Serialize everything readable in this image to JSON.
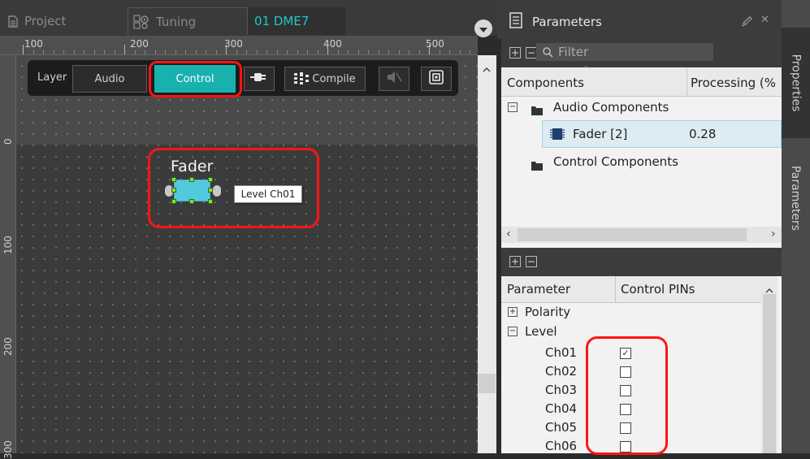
{
  "tabs": [
    {
      "label": "Project",
      "icon": "document-icon"
    },
    {
      "label": "Tuning",
      "icon": "tuning-icon"
    },
    {
      "label": "01 DME7",
      "icon": ""
    }
  ],
  "ruler": {
    "h_labels": [
      "100",
      "200",
      "300",
      "400",
      "500"
    ],
    "v_labels": [
      "0",
      "100",
      "200",
      "300"
    ]
  },
  "toolbar": {
    "layer_label": "Layer",
    "audio_label": "Audio",
    "control_label": "Control",
    "compile_label": "Compile"
  },
  "component": {
    "title": "Fader",
    "tooltip": "Level Ch01"
  },
  "panel": {
    "title": "Parameters",
    "filter_placeholder": "Filter",
    "col_components": "Components",
    "col_processing": "Processing (%",
    "audio_components": "Audio Components",
    "fader_item": "Fader [2]",
    "fader_value": "0.28",
    "control_components": "Control Components",
    "col_parameter": "Parameter",
    "col_control_pins": "Control PINs",
    "polarity": "Polarity",
    "level": "Level",
    "channels": [
      {
        "name": "Ch01",
        "checked": true
      },
      {
        "name": "Ch02",
        "checked": false
      },
      {
        "name": "Ch03",
        "checked": false
      },
      {
        "name": "Ch04",
        "checked": false
      },
      {
        "name": "Ch05",
        "checked": false
      },
      {
        "name": "Ch06",
        "checked": false
      }
    ]
  },
  "sidetabs": [
    "Properties",
    "Parameters"
  ],
  "colors": {
    "accent": "#19b1ad",
    "highlight": "#ff1414",
    "component": "#52c9dc"
  }
}
